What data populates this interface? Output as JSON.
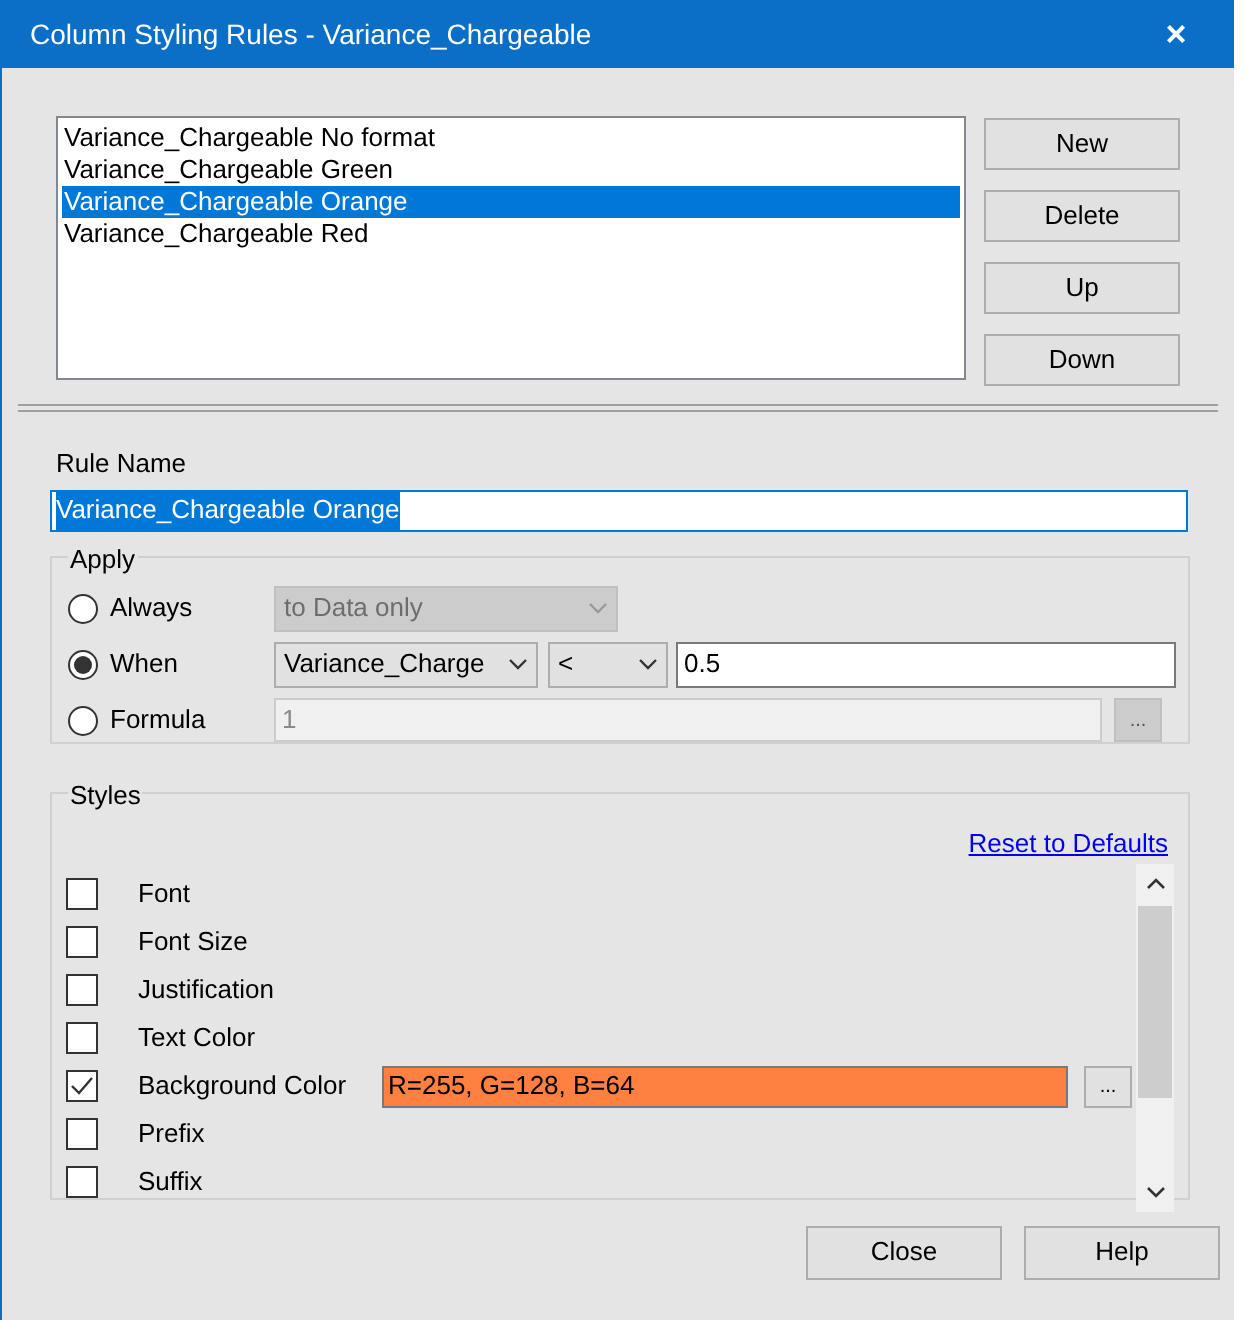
{
  "window": {
    "title": "Column Styling Rules - Variance_Chargeable",
    "close": "×"
  },
  "rules": [
    {
      "label": "Variance_Chargeable No format",
      "selected": false
    },
    {
      "label": "Variance_Chargeable Green",
      "selected": false
    },
    {
      "label": "Variance_Chargeable Orange",
      "selected": true
    },
    {
      "label": "Variance_Chargeable Red",
      "selected": false
    }
  ],
  "rule_buttons": [
    "New",
    "Delete",
    "Up",
    "Down"
  ],
  "rule_name": {
    "label": "Rule Name",
    "value": "Variance_Chargeable Orange"
  },
  "apply": {
    "title": "Apply",
    "options": [
      {
        "label": "Always",
        "selected": false,
        "kind": "dropdown",
        "dropdown": {
          "value": "to Data only",
          "disabled": true
        }
      },
      {
        "label": "When",
        "selected": true,
        "kind": "condition",
        "column": "Variance_Charge",
        "operator": "<",
        "value": "0.5"
      },
      {
        "label": "Formula",
        "selected": false,
        "kind": "formula",
        "value": "1",
        "disabled": true,
        "button": "..."
      }
    ]
  },
  "styles": {
    "title": "Styles",
    "reset_link": "Reset to Defaults",
    "items": [
      {
        "label": "Font",
        "checked": false
      },
      {
        "label": "Font Size",
        "checked": false
      },
      {
        "label": "Justification",
        "checked": false
      },
      {
        "label": "Text Color",
        "checked": false
      },
      {
        "label": "Background Color",
        "checked": true,
        "value": "R=255, G=128, B=64",
        "color": "#ff8040",
        "button": "..."
      },
      {
        "label": "Prefix",
        "checked": false
      },
      {
        "label": "Suffix",
        "checked": false
      }
    ]
  },
  "footer_buttons": [
    "Close",
    "Help"
  ]
}
